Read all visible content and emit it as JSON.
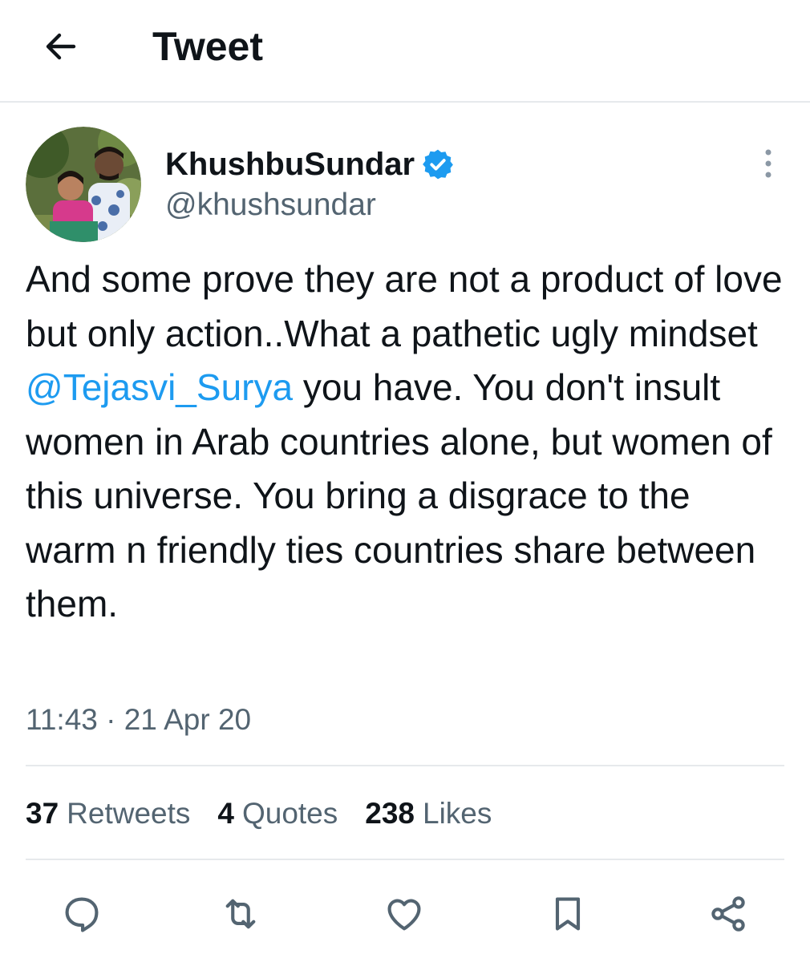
{
  "header": {
    "title": "Tweet",
    "back_icon": "arrow-left-icon"
  },
  "author": {
    "display_name": "KhushbuSundar",
    "handle": "@khushsundar",
    "verified_icon": "verified-badge-icon",
    "verified_color": "#1d9bf0"
  },
  "tweet": {
    "text_before": "And some prove they are not a product of love but only action..What a pathetic ugly mindset ",
    "mention": "@Tejasvi_Surya",
    "text_after": " you have. You don't insult women in Arab countries alone, but women of this universe. You bring a disgrace to the warm n friendly ties countries share between them.",
    "timestamp": "11:43 · 21 Apr 20"
  },
  "stats": {
    "retweets_count": "37",
    "retweets_label": "Retweets",
    "quotes_count": "4",
    "quotes_label": "Quotes",
    "likes_count": "238",
    "likes_label": "Likes"
  },
  "actions": [
    "reply-icon",
    "retweet-icon",
    "like-icon",
    "bookmark-icon",
    "share-icon"
  ],
  "colors": {
    "text_primary": "#0f1419",
    "text_secondary": "#536471",
    "link": "#1d9bf0",
    "divider": "#e6e9ec"
  }
}
